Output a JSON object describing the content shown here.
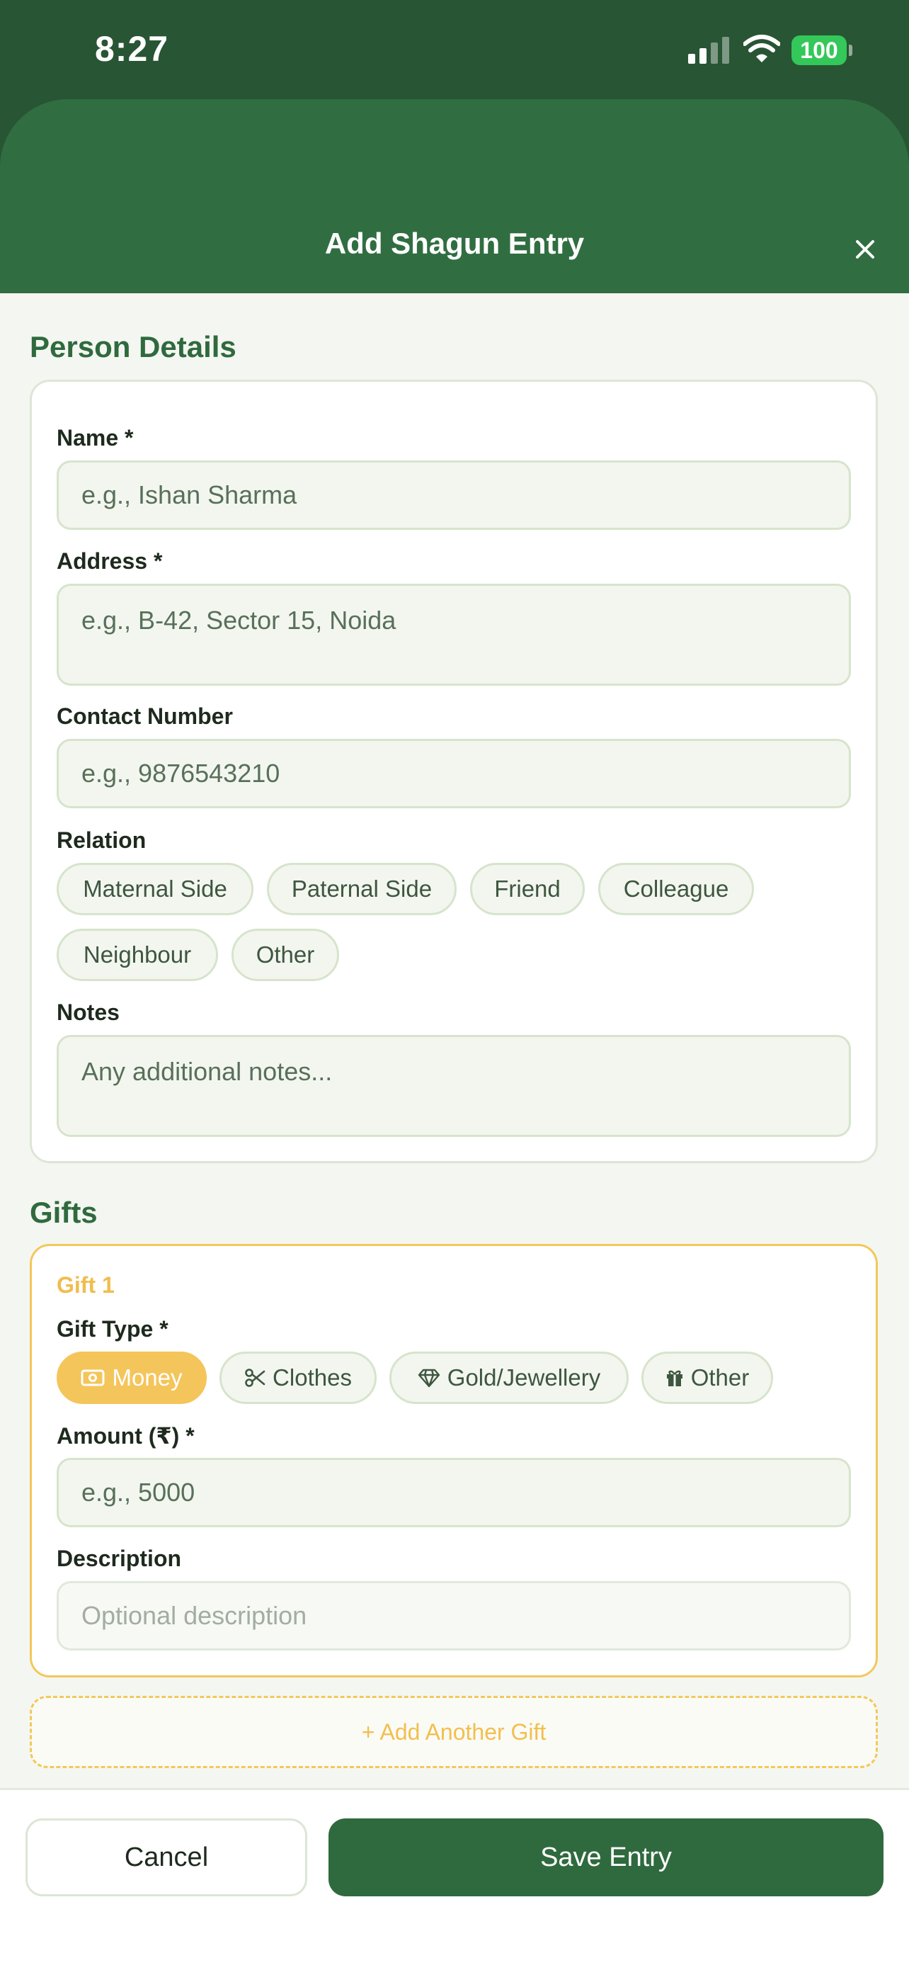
{
  "status_bar": {
    "time": "8:27",
    "battery": "100"
  },
  "header": {
    "title": "Add Shagun Entry"
  },
  "person": {
    "section_title": "Person Details",
    "name_label": "Name *",
    "name_placeholder": "e.g., Ishan Sharma",
    "address_label": "Address *",
    "address_placeholder": "e.g., B-42, Sector 15, Noida",
    "contact_label": "Contact Number",
    "contact_placeholder": "e.g., 9876543210",
    "relation_label": "Relation",
    "relations": [
      "Maternal Side",
      "Paternal Side",
      "Friend",
      "Colleague",
      "Neighbour",
      "Other"
    ],
    "notes_label": "Notes",
    "notes_placeholder": "Any additional notes..."
  },
  "gifts": {
    "section_title": "Gifts",
    "gift_title": "Gift 1",
    "type_label": "Gift Type *",
    "types": [
      {
        "label": "Money",
        "icon": "money-icon",
        "selected": true
      },
      {
        "label": "Clothes",
        "icon": "scissors-icon",
        "selected": false
      },
      {
        "label": "Gold/Jewellery",
        "icon": "diamond-icon",
        "selected": false
      },
      {
        "label": "Other",
        "icon": "gift-icon",
        "selected": false
      }
    ],
    "amount_label": "Amount (₹) *",
    "amount_placeholder": "e.g., 5000",
    "description_label": "Description",
    "description_placeholder": "Optional description",
    "add_another": "+ Add Another Gift"
  },
  "footer": {
    "cancel": "Cancel",
    "save": "Save Entry"
  },
  "colors": {
    "primary": "#2f6a3e",
    "header_bg": "#285534",
    "accent": "#f4c55a",
    "battery": "#34c759"
  }
}
